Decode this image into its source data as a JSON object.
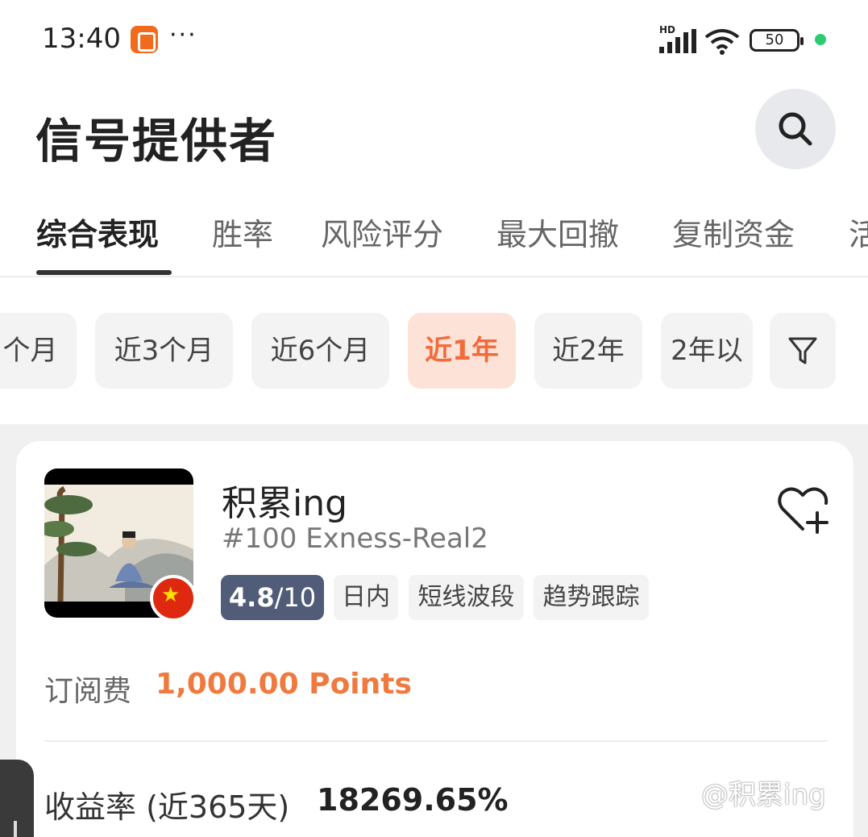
{
  "status_bar": {
    "time": "13:40",
    "dots": "···",
    "hd_label": "HD",
    "battery": "50"
  },
  "header": {
    "title": "信号提供者"
  },
  "tabs": [
    {
      "label": "综合表现",
      "active": true
    },
    {
      "label": "胜率",
      "active": false
    },
    {
      "label": "风险评分",
      "active": false
    },
    {
      "label": "最大回撤",
      "active": false
    },
    {
      "label": "复制资金",
      "active": false
    },
    {
      "label": "活",
      "active": false
    }
  ],
  "period_chips": [
    {
      "label": "个月",
      "active": false
    },
    {
      "label": "近3个月",
      "active": false
    },
    {
      "label": "近6个月",
      "active": false
    },
    {
      "label": "近1年",
      "active": true
    },
    {
      "label": "近2年",
      "active": false
    },
    {
      "label": "2年以",
      "active": false
    }
  ],
  "trader": {
    "name": "积累ing",
    "id": "#100 Exness-Real2",
    "score": "4.8",
    "score_max": "/10",
    "tags": [
      "日内",
      "短线波段",
      "趋势跟踪"
    ],
    "fee_label": "订阅费",
    "fee_value": "1,000.00 Points",
    "return_label": "收益率 (近365天)",
    "return_value": "18269.65%"
  },
  "watermark": "@积累ing",
  "colors": {
    "accent": "#f26b3a",
    "score_badge": "#515c79",
    "chip_active_bg": "#fde2d7"
  }
}
